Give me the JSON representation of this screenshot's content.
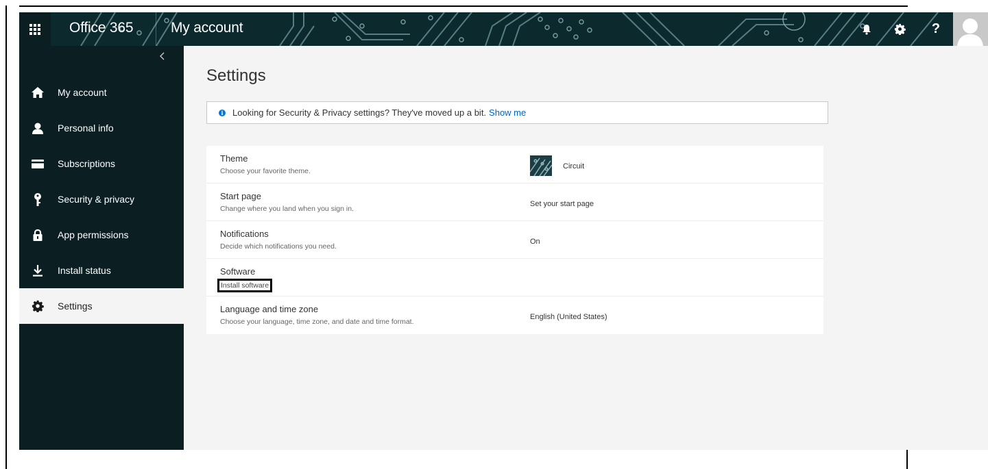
{
  "topbar": {
    "app_title": "Office 365",
    "section_title": "My account",
    "icons": [
      "app-launcher-icon",
      "bell-icon",
      "gear-icon",
      "help-icon",
      "user-avatar"
    ]
  },
  "sidebar": {
    "collapse_icon": "chevron-left-icon",
    "items": [
      {
        "label": "My account",
        "icon": "home-icon"
      },
      {
        "label": "Personal info",
        "icon": "person-icon"
      },
      {
        "label": "Subscriptions",
        "icon": "card-icon"
      },
      {
        "label": "Security & privacy",
        "icon": "key-icon"
      },
      {
        "label": "App permissions",
        "icon": "lock-icon"
      },
      {
        "label": "Install status",
        "icon": "download-icon"
      },
      {
        "label": "Settings",
        "icon": "gear-icon",
        "active": true
      }
    ]
  },
  "main": {
    "title": "Settings",
    "info_text": "Looking for Security & Privacy settings? They've moved up a bit.",
    "info_link": "Show me",
    "rows": [
      {
        "title": "Theme",
        "desc": "Choose your favorite theme.",
        "value": "Circuit"
      },
      {
        "title": "Start page",
        "desc": "Change where you land when you sign in.",
        "value": "Set your start page"
      },
      {
        "title": "Notifications",
        "desc": "Decide which notifications you need.",
        "value": "On"
      },
      {
        "title": "Software",
        "link": "Install software"
      },
      {
        "title": "Language and time zone",
        "desc": "Choose your language, time zone, and date and time format.",
        "value": "English (United States)"
      }
    ]
  },
  "colors": {
    "topbar_bg": "#0c2a2e",
    "sidebar_bg": "#0b1f23",
    "main_bg": "#f4f4f4",
    "link": "#0062c3",
    "info_icon": "#0078d7"
  }
}
